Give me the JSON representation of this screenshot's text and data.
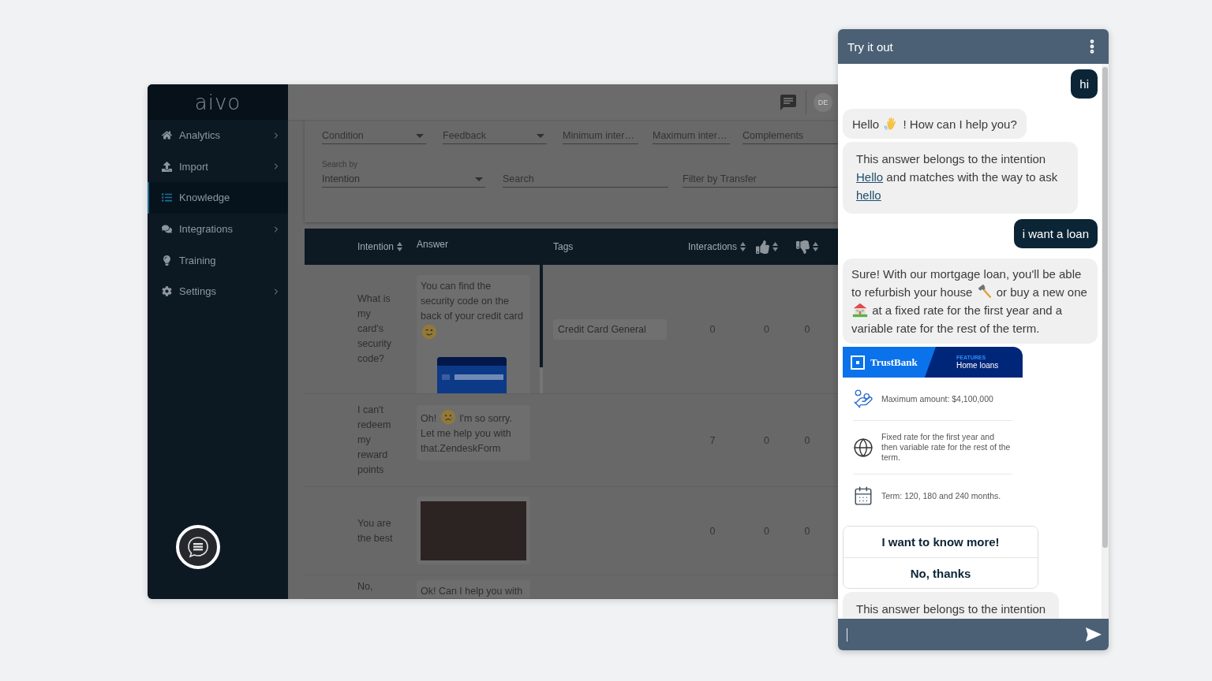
{
  "sidebar": {
    "logo": "aivo",
    "items": [
      {
        "label": "Analytics",
        "selected": false,
        "submenu": true
      },
      {
        "label": "Import",
        "selected": false,
        "submenu": true
      },
      {
        "label": "Knowledge",
        "selected": true,
        "submenu": false
      },
      {
        "label": "Integrations",
        "selected": false,
        "submenu": true
      },
      {
        "label": "Training",
        "selected": false,
        "submenu": false
      },
      {
        "label": "Settings",
        "selected": false,
        "submenu": true
      }
    ]
  },
  "topbar": {
    "avatar": "DE"
  },
  "filters": [
    [
      {
        "kind": "select",
        "placeholder": "Condition"
      },
      {
        "kind": "select",
        "placeholder": "Feedback"
      },
      {
        "kind": "text",
        "placeholder": "Minimum inter…"
      },
      {
        "kind": "text",
        "placeholder": "Maximum inter…"
      },
      {
        "kind": "text",
        "placeholder": "Complements"
      }
    ],
    [
      {
        "kind": "select",
        "label": "Search by",
        "value": "Intention"
      },
      {
        "kind": "text",
        "placeholder": "Search"
      },
      {
        "kind": "text",
        "placeholder": "Filter by Transfer"
      }
    ]
  ],
  "table": {
    "columns": [
      {
        "kind": "text",
        "label": "Intention",
        "sortable": true
      },
      {
        "kind": "text",
        "label": "Answer",
        "sortable": false
      },
      {
        "kind": "text",
        "label": "Tags",
        "sortable": false
      },
      {
        "kind": "text",
        "label": "Interactions",
        "sortable": true
      },
      {
        "kind": "thumb_up",
        "sortable": true
      },
      {
        "kind": "thumb_down",
        "sortable": true
      }
    ],
    "rows": [
      {
        "intention": "What is my card's security code?",
        "answer": {
          "parts": [
            {
              "kind": "text",
              "text": "You can find the security code on the back of your credit card"
            },
            {
              "kind": "wink"
            }
          ],
          "media": {
            "kind": "card_image"
          },
          "scrollbar": true
        },
        "tag": "Credit Card General",
        "interactions": "0",
        "likes": "0",
        "dislikes": "0"
      },
      {
        "intention": "I can't redeem my reward points",
        "answer": {
          "parts": [
            {
              "kind": "text",
              "text": "Oh!"
            },
            {
              "kind": "sad"
            },
            {
              "kind": "text",
              "text": "I'm so sorry. Let me help you with that.ZendeskForm"
            }
          ]
        },
        "interactions": "7",
        "likes": "0",
        "dislikes": "0"
      },
      {
        "intention": "You are the best",
        "answer": {
          "media": {
            "kind": "photo"
          }
        },
        "interactions": "0",
        "likes": "0",
        "dislikes": "0"
      },
      {
        "intention": "No,",
        "answer": {
          "parts": [
            {
              "kind": "text",
              "text": "Ok! Can I help you with"
            }
          ]
        }
      }
    ]
  },
  "chat": {
    "title": "Try it out",
    "messages": [
      {
        "kind": "user",
        "text": "hi"
      },
      {
        "kind": "bot",
        "parts": [
          {
            "kind": "text",
            "text": "Hello"
          },
          {
            "kind": "wave"
          },
          {
            "kind": "text",
            "text": "! How can I help you?"
          }
        ]
      },
      {
        "kind": "info",
        "parts": [
          {
            "kind": "text",
            "text": "This answer belongs to the intention"
          },
          {
            "kind": "link",
            "text": "Hello"
          },
          {
            "kind": "text",
            "text": "and matches with the way to ask"
          },
          {
            "kind": "link",
            "text": "hello"
          }
        ]
      },
      {
        "kind": "user",
        "text": "i want a loan"
      },
      {
        "kind": "bot",
        "parts": [
          {
            "kind": "text",
            "text": "Sure! With our mortgage loan, you'll be able to refurbish your house"
          },
          {
            "kind": "hammer"
          },
          {
            "kind": "text",
            "text": "or buy a new one"
          },
          {
            "kind": "house"
          },
          {
            "kind": "text",
            "text": "at a fixed rate for the first year and a variable rate for the rest of the term."
          }
        ]
      },
      {
        "kind": "card",
        "brand": "TrustBank",
        "eyebrow": "FEATURES",
        "title": "Home loans",
        "features": [
          "Maximum amount: $4,100,000",
          "Fixed rate for the first year and then variable rate for the rest of the term.",
          "Term: 120, 180 and 240 months."
        ]
      },
      {
        "kind": "quick_replies",
        "options": [
          "I want to know more!",
          "No, thanks"
        ]
      },
      {
        "kind": "info",
        "parts": [
          {
            "kind": "text",
            "text": "This answer belongs to the intention"
          }
        ]
      }
    ],
    "input": {
      "focused": true
    }
  }
}
